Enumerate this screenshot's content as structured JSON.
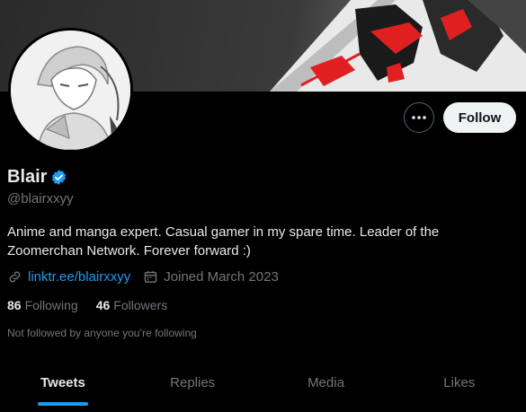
{
  "profile": {
    "display_name": "Blair",
    "handle": "@blairxxyy",
    "bio": "Anime and manga expert. Casual gamer in my spare time. Leader of the Zoomerchan Network. Forever forward :)",
    "link": "linktr.ee/blairxxyy",
    "joined": "Joined March 2023",
    "following_count": "86",
    "following_label": "Following",
    "followers_count": "46",
    "followers_label": "Followers",
    "followed_by": "Not followed by anyone you’re following"
  },
  "actions": {
    "more_icon": "more-horizontal-icon",
    "follow_label": "Follow"
  },
  "tabs": [
    {
      "label": "Tweets",
      "active": true
    },
    {
      "label": "Replies",
      "active": false
    },
    {
      "label": "Media",
      "active": false
    },
    {
      "label": "Likes",
      "active": false
    }
  ],
  "colors": {
    "accent": "#1d9bf0",
    "background": "#000000",
    "text_primary": "#e7e9ea",
    "text_secondary": "#71767b",
    "banner_red": "#e02020"
  }
}
